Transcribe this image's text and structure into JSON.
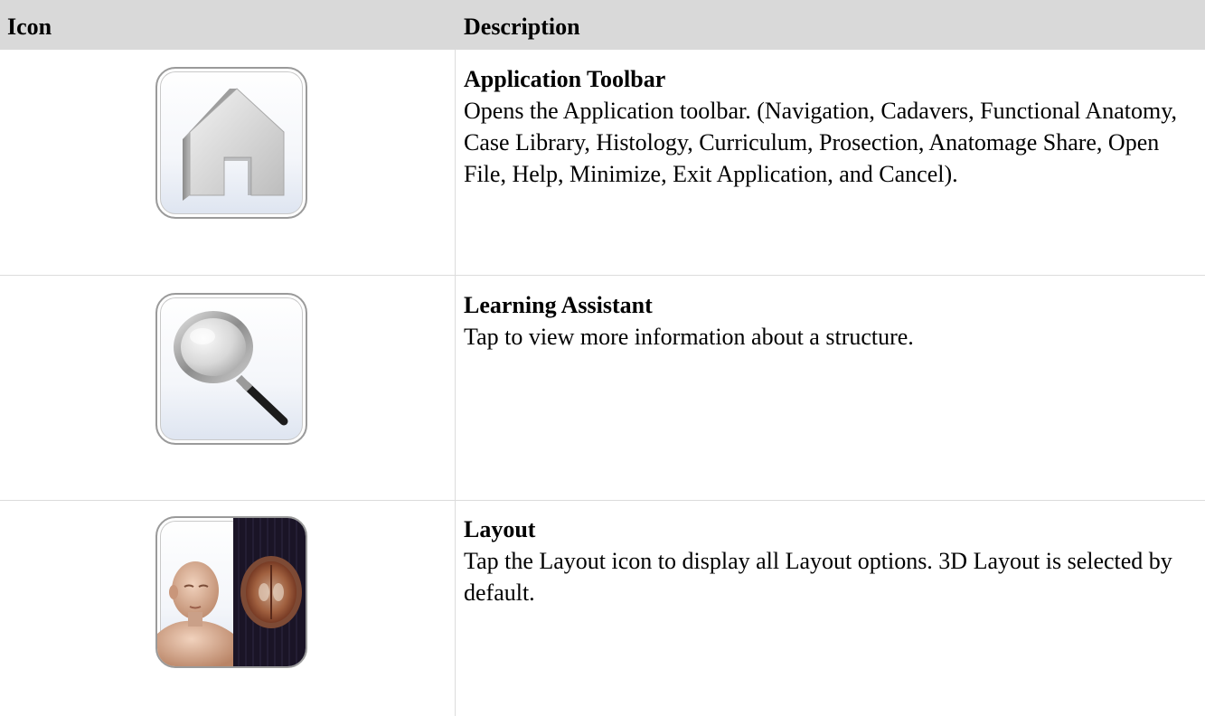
{
  "header": {
    "icon_col": "Icon",
    "desc_col": "Description"
  },
  "rows": [
    {
      "icon": "home-icon",
      "title": "Application Toolbar",
      "text": "Opens the Application toolbar. (Navigation, Cadavers, Functional Anatomy, Case Library, Histology, Curriculum, Prosection, Anatomage Share, Open File, Help, Minimize, Exit Application, and Cancel)."
    },
    {
      "icon": "magnifier-icon",
      "title": "Learning Assistant",
      "text": "Tap to view more information about a structure."
    },
    {
      "icon": "layout-icon",
      "title": "Layout",
      "text": "Tap the Layout icon to display all Layout options.  3D Layout is selected by default."
    }
  ],
  "colors": {
    "header_bg": "#d9d9d9",
    "grid_line": "#dcdcdc",
    "tile_border": "#9a9a9a"
  }
}
